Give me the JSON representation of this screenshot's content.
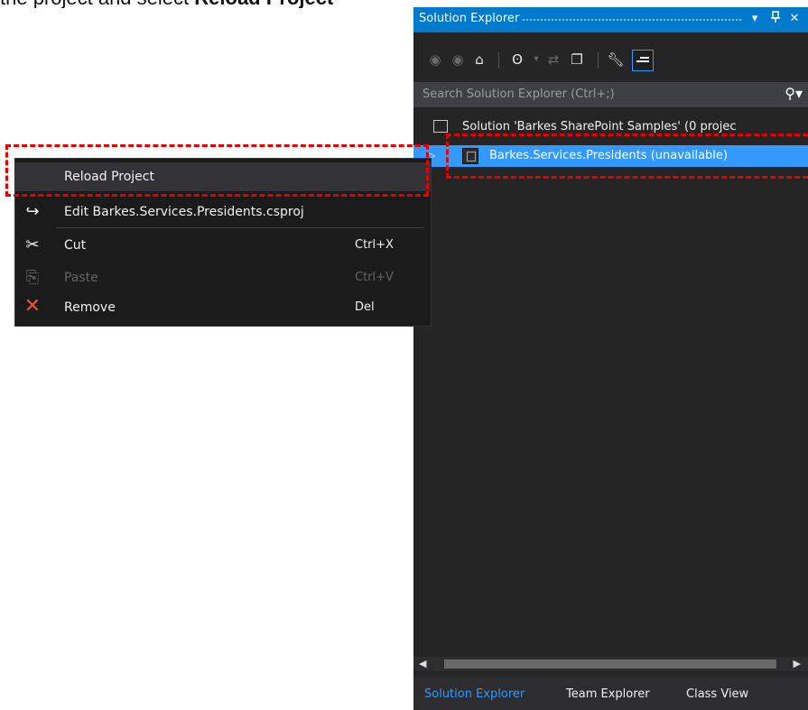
{
  "caption": {
    "text_prefix": "the project and select",
    "text_bold": "Reload Project"
  },
  "solution_explorer": {
    "title": "Solution Explorer",
    "titlebar_buttons": {
      "dropdown": "▾",
      "pin": "ᵖ",
      "close": "✕"
    },
    "toolbar_icons": [
      "back-icon",
      "forward-icon",
      "home-icon",
      "pending-changes-icon",
      "sync-icon",
      "collapse-all-icon",
      "properties-icon",
      "preview-icon"
    ],
    "search": {
      "placeholder": "Search Solution Explorer (Ctrl+;)"
    },
    "tree": {
      "solution": {
        "label": "Solution 'Barkes SharePoint Samples' (0 projec"
      },
      "project": {
        "label": "Barkes.Services.Presidents (unavailable)",
        "selected": true
      }
    },
    "tabs": [
      {
        "label": "Solution Explorer",
        "active": true
      },
      {
        "label": "Team Explorer",
        "active": false
      },
      {
        "label": "Class View",
        "active": false
      }
    ]
  },
  "context_menu": {
    "items": [
      {
        "label": "Reload Project",
        "shortcut": "",
        "icon": "",
        "enabled": true,
        "highlighted": true
      },
      {
        "label": "Edit Barkes.Services.Presidents.csproj",
        "shortcut": "",
        "icon": "redo-arrow-icon",
        "enabled": true
      },
      {
        "label": "Cut",
        "shortcut": "Ctrl+X",
        "icon": "scissors-icon",
        "enabled": true
      },
      {
        "label": "Paste",
        "shortcut": "Ctrl+V",
        "icon": "clipboard-icon",
        "enabled": false
      },
      {
        "label": "Remove",
        "shortcut": "Del",
        "icon": "x-icon",
        "enabled": true
      }
    ]
  },
  "colors": {
    "accent": "#007acc",
    "selection": "#3399ff",
    "panel_bg": "#252526",
    "menu_bg": "#1b1b1c",
    "highlight_border": "#e60000",
    "remove_icon": "#e8543f"
  }
}
